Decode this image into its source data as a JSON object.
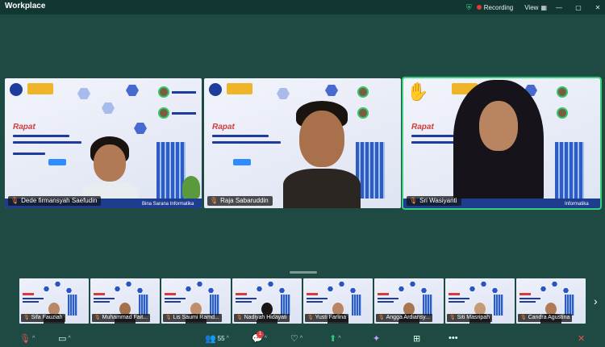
{
  "app": {
    "title": "Workplace"
  },
  "status": {
    "recording": "Recording",
    "view": "View"
  },
  "participants_main": [
    {
      "name": "Dede firmansyah Saefudin",
      "footer": "Bina Sarana Informatika"
    },
    {
      "name": "Raja Sabaruddin",
      "footer": ""
    },
    {
      "name": "Sri Wasiyanti",
      "footer": "Informatika"
    }
  ],
  "participants_strip": [
    "Sifa Fauziah",
    "Muhammad Fait...",
    "Lis Saumi Ramd...",
    "Nadiyah Hidayati",
    "Yusti Farlina",
    "Angga Ardiansy...",
    "Siti Masripah",
    "Candra Agustina"
  ],
  "toolbar": {
    "participants_count": "55",
    "chat_badge": "1"
  },
  "colors": {
    "background": "#1f4a44",
    "active_speaker": "#35d07a",
    "record": "#e23b3b",
    "poster_blue": "#1d3c9b",
    "poster_red": "#d43c3c"
  },
  "icons": [
    "mic-icon",
    "video-icon",
    "participants-icon",
    "chat-icon",
    "reactions-icon",
    "share-icon",
    "apps-icon",
    "ai-icon",
    "more-icon",
    "end-icon",
    "raise-hand-icon",
    "shield-icon",
    "grid-icon"
  ]
}
